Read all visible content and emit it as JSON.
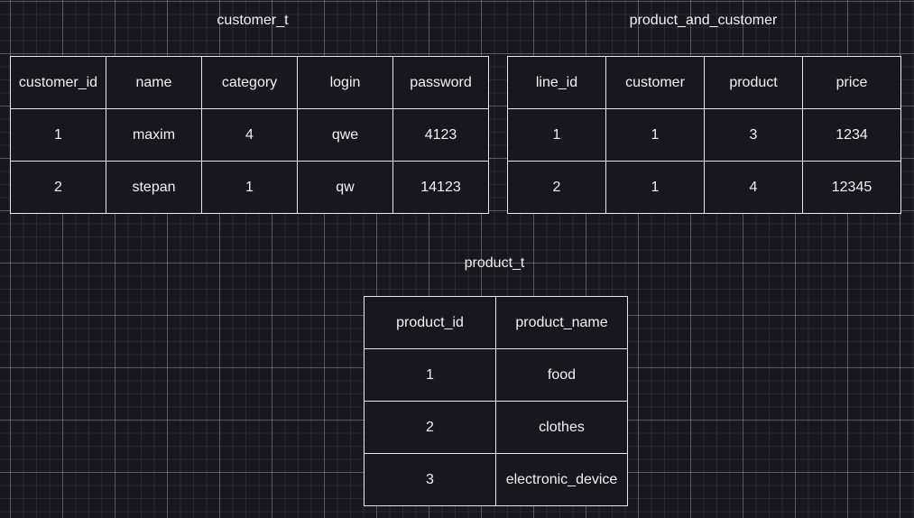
{
  "tables": {
    "customer": {
      "title": "customer_t",
      "header": [
        "customer_id",
        "name",
        "category",
        "login",
        "password"
      ],
      "rows": [
        [
          "1",
          "maxim",
          "4",
          "qwe",
          "4123"
        ],
        [
          "2",
          "stepan",
          "1",
          "qw",
          "14123"
        ]
      ]
    },
    "product_and_customer": {
      "title": "product_and_customer",
      "header": [
        "line_id",
        "customer",
        "product",
        "price"
      ],
      "rows": [
        [
          "1",
          "1",
          "3",
          "1234"
        ],
        [
          "2",
          "1",
          "4",
          "12345"
        ]
      ]
    },
    "product": {
      "title": "product_t",
      "header": [
        "product_id",
        "product_name"
      ],
      "rows": [
        [
          "1",
          "food"
        ],
        [
          "2",
          "clothes"
        ],
        [
          "3",
          "electronic_device"
        ]
      ]
    }
  },
  "colors": {
    "canvas_background": "#18161e",
    "border": "#e8e8e8",
    "text": "#f2f2f2"
  }
}
